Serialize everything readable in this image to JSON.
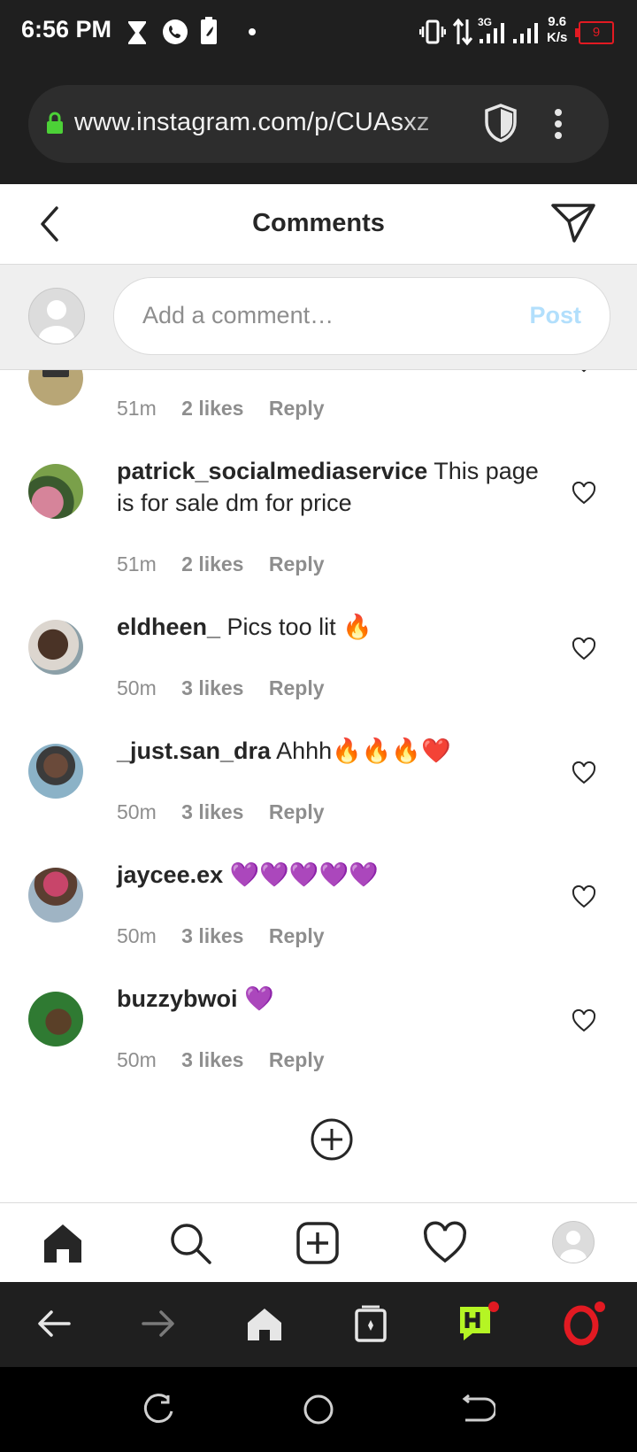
{
  "status_bar": {
    "time": "6:56 PM",
    "network": "3G",
    "speed_value": "9.6",
    "speed_unit": "K/s",
    "battery": "9",
    "icons": [
      "hourglass-icon",
      "whatsapp-icon",
      "battery-saver-icon",
      "dot-icon",
      "vibrate-icon",
      "data-arrows-icon",
      "signal-icon",
      "signal-icon",
      "battery-icon"
    ]
  },
  "browser": {
    "url": "www.instagram.com/p/CUAsxz",
    "icons": [
      "lock-icon",
      "shield-icon",
      "more-vert-icon"
    ]
  },
  "header": {
    "title": "Comments",
    "icons": [
      "back-chevron-icon",
      "direct-send-icon"
    ]
  },
  "composer": {
    "placeholder": "Add a comment…",
    "post_label": "Post"
  },
  "comments": [
    {
      "username": "",
      "text": "",
      "time": "51m",
      "likes": "2 likes",
      "reply": "Reply"
    },
    {
      "username": "patrick_socialmediaservice",
      "text": " This page is for sale dm for price",
      "time": "51m",
      "likes": "2 likes",
      "reply": "Reply"
    },
    {
      "username": "eldheen_",
      "text": " Pics too lit 🔥",
      "time": "50m",
      "likes": "3 likes",
      "reply": "Reply"
    },
    {
      "username": "_just.san_dra",
      "text": " Ahhh🔥🔥🔥❤️",
      "time": "50m",
      "likes": "3 likes",
      "reply": "Reply"
    },
    {
      "username": "jaycee.ex",
      "text": " 💜💜💜💜💜",
      "time": "50m",
      "likes": "3 likes",
      "reply": "Reply"
    },
    {
      "username": "buzzybwoi",
      "text": " 💜",
      "time": "50m",
      "likes": "3 likes",
      "reply": "Reply"
    }
  ],
  "load_more_icon": "add-circle-icon",
  "ig_nav": [
    "home-icon",
    "search-icon",
    "new-post-icon",
    "activity-heart-icon",
    "profile-avatar"
  ],
  "browser_nav": [
    "back-arrow-icon",
    "forward-arrow-icon",
    "home-icon",
    "tabs-icon",
    "hype-icon",
    "opera-icon"
  ],
  "system_nav": [
    "recents-icon",
    "home-circle-icon",
    "back-icon"
  ],
  "colors": {
    "accent_post_disabled": "#b2dffc",
    "opera_red": "#e21a22",
    "hype_green": "#b5f524",
    "text": "#262626",
    "muted": "#8e8e8e"
  }
}
